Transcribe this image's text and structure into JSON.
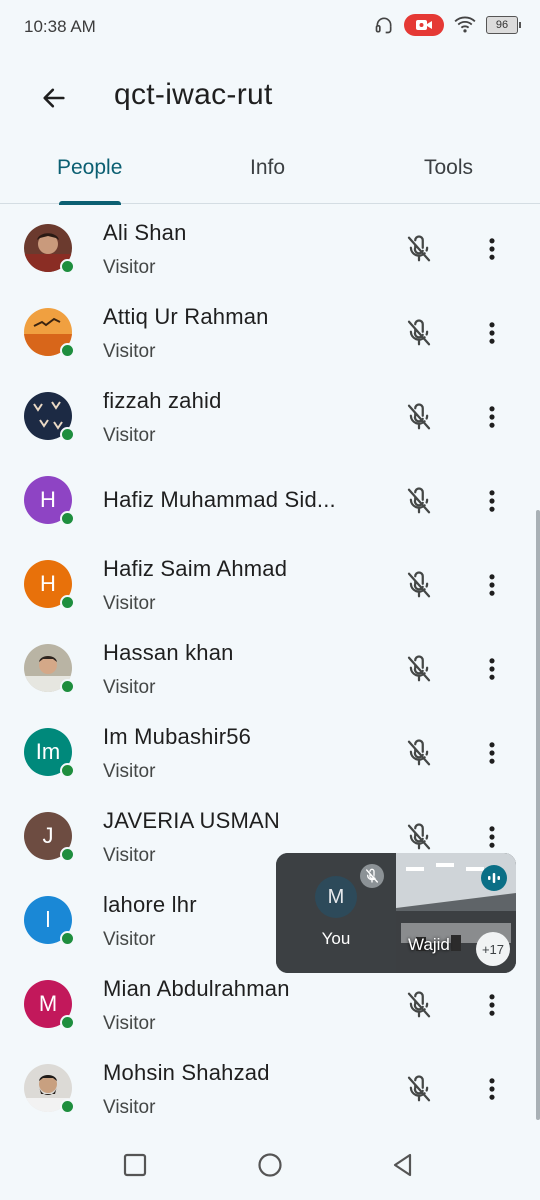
{
  "status": {
    "time": "10:38 AM",
    "battery": "96"
  },
  "header": {
    "title": "qct-iwac-rut"
  },
  "tabs": [
    {
      "label": "People"
    },
    {
      "label": "Info"
    },
    {
      "label": "Tools"
    }
  ],
  "people": [
    {
      "name": "Ali Shan",
      "role": "Visitor",
      "avatar_type": "photo"
    },
    {
      "name": "Attiq Ur Rahman",
      "role": "Visitor",
      "avatar_type": "photo"
    },
    {
      "name": "fizzah zahid",
      "role": "Visitor",
      "avatar_type": "photo"
    },
    {
      "name": "Hafiz Muhammad Sid...",
      "role": "",
      "avatar_type": "letter",
      "initials": "H",
      "color": "#8e44c4"
    },
    {
      "name": "Hafiz Saim Ahmad",
      "role": "Visitor",
      "avatar_type": "letter",
      "initials": "H",
      "color": "#e8710a"
    },
    {
      "name": "Hassan khan",
      "role": "Visitor",
      "avatar_type": "photo"
    },
    {
      "name": "Im Mubashir56",
      "role": "Visitor",
      "avatar_type": "letter",
      "initials": "Im",
      "color": "#00897b"
    },
    {
      "name": "JAVERIA USMAN",
      "role": "Visitor",
      "avatar_type": "letter",
      "initials": "J",
      "color": "#6d4c41"
    },
    {
      "name": "lahore lhr",
      "role": "Visitor",
      "avatar_type": "letter",
      "initials": "l",
      "color": "#1a88d6"
    },
    {
      "name": "Mian Abdulrahman",
      "role": "Visitor",
      "avatar_type": "letter",
      "initials": "M",
      "color": "#c2185b"
    },
    {
      "name": "Mohsin Shahzad",
      "role": "Visitor",
      "avatar_type": "photo"
    }
  ],
  "pip": {
    "self_initial": "M",
    "self_label": "You",
    "remote_name": "Wajid",
    "participant_count": "+17"
  },
  "colors": {
    "accent": "#0b5f72",
    "online": "#1e8e3e",
    "recording": "#e53935"
  }
}
